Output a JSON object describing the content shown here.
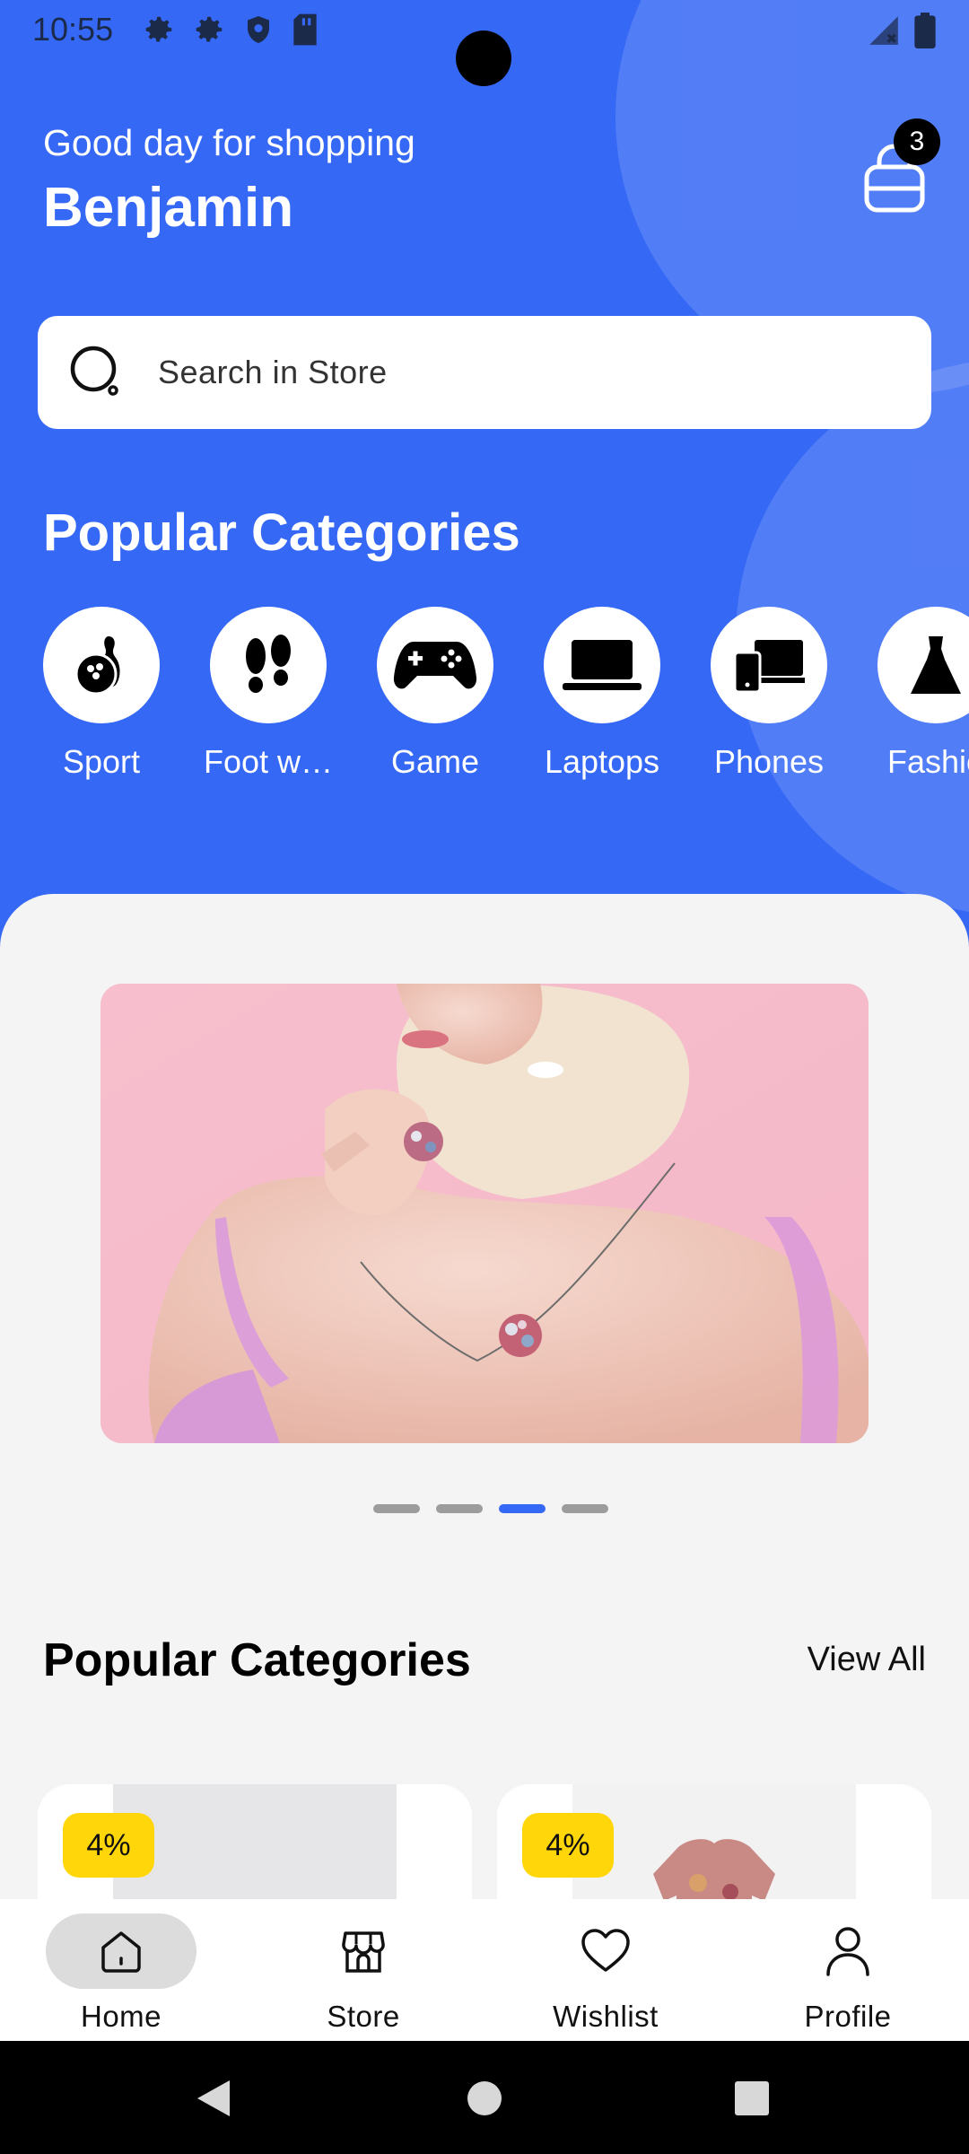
{
  "status_bar": {
    "time": "10:55",
    "icons_left": [
      "gear-icon",
      "gear-icon",
      "shield-icon",
      "sd-card-icon"
    ],
    "icons_right": [
      "signal-icon",
      "battery-icon"
    ]
  },
  "header": {
    "greeting": "Good day for shopping",
    "username": "Benjamin",
    "cart_count": "3",
    "background_color": "#3568f5"
  },
  "search": {
    "placeholder": "Search in Store"
  },
  "categories_section": {
    "title": "Popular Categories",
    "items": [
      {
        "label": "Sport",
        "icon": "bowling-icon"
      },
      {
        "label": "Foot w…",
        "icon": "footprints-icon"
      },
      {
        "label": "Game",
        "icon": "gamepad-icon"
      },
      {
        "label": "Laptops",
        "icon": "laptop-icon"
      },
      {
        "label": "Phones",
        "icon": "devices-icon"
      },
      {
        "label": "Fashio",
        "icon": "dress-icon"
      }
    ]
  },
  "carousel": {
    "slide_count": 4,
    "active_index": 2
  },
  "products_section": {
    "title": "Popular Categories",
    "view_all": "View All",
    "products": [
      {
        "discount": "4%"
      },
      {
        "discount": "4%"
      }
    ]
  },
  "bottom_nav": {
    "items": [
      {
        "label": "Home",
        "icon": "home-icon",
        "active": true
      },
      {
        "label": "Store",
        "icon": "store-icon",
        "active": false
      },
      {
        "label": "Wishlist",
        "icon": "heart-icon",
        "active": false
      },
      {
        "label": "Profile",
        "icon": "user-icon",
        "active": false
      }
    ]
  },
  "colors": {
    "accent": "#3568f5",
    "discount_badge": "#ffd60a"
  }
}
